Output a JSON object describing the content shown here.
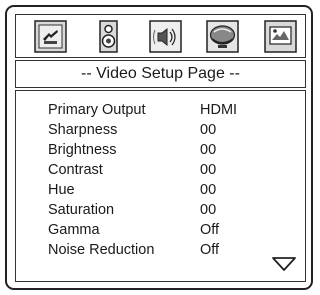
{
  "toolbar": {
    "icons": [
      "general-setup-icon",
      "speaker-setup-icon",
      "audio-setup-icon",
      "video-setup-icon",
      "preference-icon"
    ]
  },
  "page_title": "-- Video Setup Page --",
  "settings": [
    {
      "label": "Primary Output",
      "value": "HDMI"
    },
    {
      "label": "Sharpness",
      "value": "00"
    },
    {
      "label": "Brightness",
      "value": "00"
    },
    {
      "label": "Contrast",
      "value": "00"
    },
    {
      "label": "Hue",
      "value": "00"
    },
    {
      "label": "Saturation",
      "value": "00"
    },
    {
      "label": "Gamma",
      "value": "Off"
    },
    {
      "label": "Noise Reduction",
      "value": "Off"
    }
  ],
  "colors": {
    "border": "#222222",
    "icon_bg": "#d9d9d9",
    "selected": "#e5e5e5"
  }
}
